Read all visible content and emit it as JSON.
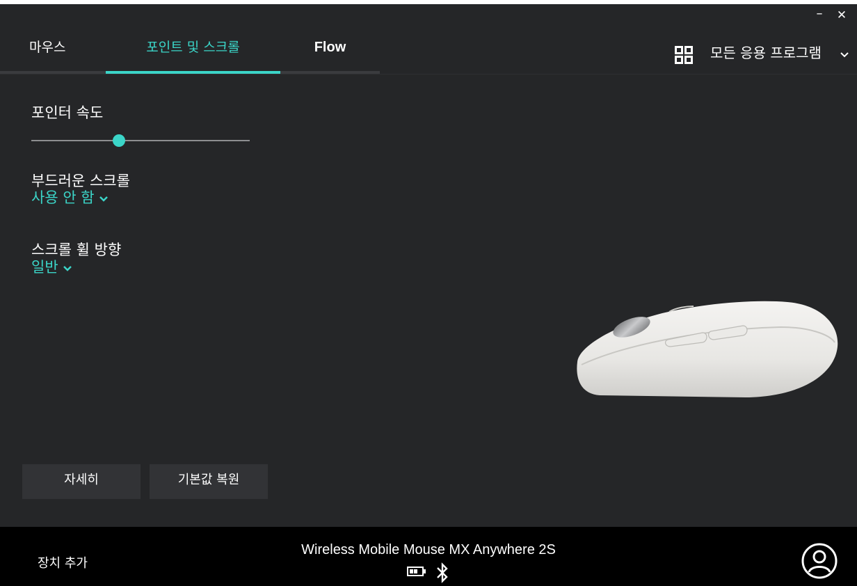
{
  "window": {
    "minimize_label": "–",
    "close_label": "✕"
  },
  "tabs": [
    {
      "label": "마우스"
    },
    {
      "label": "포인트 및 스크롤"
    },
    {
      "label": "Flow"
    }
  ],
  "apps": {
    "label": "모든 응용 프로그램",
    "icon": "grid-icon"
  },
  "settings": {
    "pointer_speed": {
      "title": "포인터 속도",
      "level": 0.4
    },
    "smooth_scroll": {
      "title": "부드러운 스크롤",
      "value": "사용 안 함"
    },
    "scroll_direction": {
      "title": "스크롤 휠 방향",
      "value": "일반"
    }
  },
  "buttons": {
    "more": "자세히",
    "reset": "기본값 복원"
  },
  "footer": {
    "add_device": "장치 추가",
    "device_name": "Wireless Mobile Mouse MX Anywhere 2S"
  },
  "colors": {
    "accent": "#3bd5c8",
    "background": "#252628",
    "footer": "#000000"
  }
}
